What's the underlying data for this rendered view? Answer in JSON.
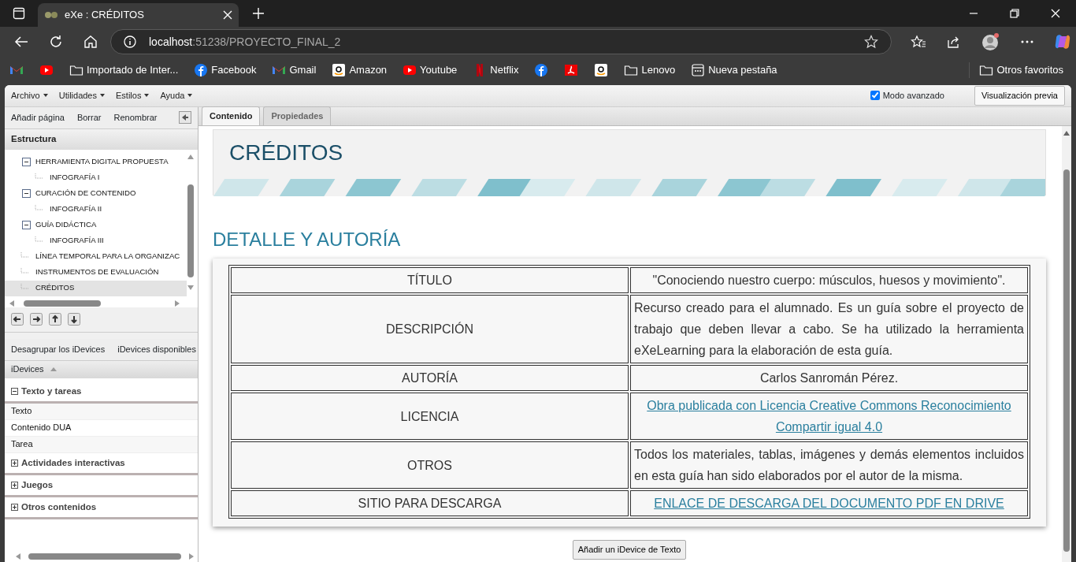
{
  "browser": {
    "tab_title": "eXe : CRÉDITOS",
    "address_host": "localhost",
    "address_rest": ":51238/PROYECTO_FINAL_2",
    "bookmarks": [
      {
        "kind": "gmail"
      },
      {
        "kind": "youtube"
      },
      {
        "kind": "folder",
        "label": "Importado de Inter..."
      },
      {
        "kind": "facebook",
        "label": "Facebook"
      },
      {
        "kind": "gmail",
        "label": "Gmail"
      },
      {
        "kind": "amazon",
        "label": "Amazon"
      },
      {
        "kind": "youtube",
        "label": "Youtube"
      },
      {
        "kind": "netflix",
        "label": "Netflix"
      },
      {
        "kind": "facebook"
      },
      {
        "kind": "santander"
      },
      {
        "kind": "amazon"
      },
      {
        "kind": "folder",
        "label": "Lenovo"
      },
      {
        "kind": "page",
        "label": "Nueva pestaña"
      }
    ],
    "other_favorites": "Otros favoritos"
  },
  "app": {
    "menus": [
      "Archivo",
      "Utilidades",
      "Estilos",
      "Ayuda"
    ],
    "advanced_mode": {
      "label": "Modo avanzado",
      "checked": true
    },
    "preview_button": "Visualización previa",
    "outline_toolbar": [
      "Añadir página",
      "Borrar",
      "Renombrar"
    ],
    "structure_title": "Estructura",
    "tree": [
      {
        "label": "HERRAMIENTA DIGITAL PROPUESTA",
        "expanded": true,
        "selected": false,
        "children": [
          {
            "label": "INFOGRAFÍA I",
            "selected": false
          }
        ]
      },
      {
        "label": "CURACIÓN DE CONTENIDO",
        "expanded": true,
        "selected": false,
        "children": [
          {
            "label": "INFOGRAFÍA II",
            "selected": false
          }
        ]
      },
      {
        "label": "GUÍA DIDÁCTICA",
        "expanded": true,
        "selected": false,
        "children": [
          {
            "label": "INFOGRAFÍA III",
            "selected": false
          }
        ]
      },
      {
        "label": "LÍNEA TEMPORAL PARA LA ORGANIZAC",
        "selected": false
      },
      {
        "label": "INSTRUMENTOS DE EVALUACIÓN",
        "selected": false
      },
      {
        "label": "CRÉDITOS",
        "selected": true
      }
    ],
    "idevices_toolbar": [
      "Desagrupar los iDevices",
      "iDevices disponibles"
    ],
    "idevices_header": "iDevices",
    "idevice_groups": [
      {
        "title": "Texto y tareas",
        "expanded": true,
        "items": [
          "Texto",
          "Contenido DUA",
          "Tarea"
        ]
      },
      {
        "title": "Actividades interactivas",
        "expanded": false
      },
      {
        "title": "Juegos",
        "expanded": false
      },
      {
        "title": "Otros contenidos",
        "expanded": false
      }
    ],
    "tabs": [
      {
        "label": "Contenido",
        "selected": true
      },
      {
        "label": "Propiedades",
        "selected": false
      }
    ],
    "page_title": "CRÉDITOS",
    "section_heading": "DETALLE Y AUTORÍA",
    "table": [
      {
        "label": "TÍTULO",
        "kind": "short",
        "value": "\"Conociendo nuestro cuerpo: músculos, huesos y movimiento\"."
      },
      {
        "label": "DESCRIPCIÓN",
        "kind": "paragraph",
        "value": "Recurso creado para el alumnado. Es un guía sobre el proyecto de trabajo que deben llevar a cabo. Se ha utilizado la herramienta eXeLearning para la elaboración de esta guía."
      },
      {
        "label": "AUTORÍA",
        "kind": "short",
        "value": "Carlos Sanromán Pérez."
      },
      {
        "label": "LICENCIA",
        "kind": "link",
        "value": "Obra publicada con Licencia Creative Commons Reconocimiento Compartir igual 4.0"
      },
      {
        "label": "OTROS",
        "kind": "paragraph",
        "value": "Todos los materiales, tablas, imágenes y demás elementos incluidos en esta guía han sido elaborados por el autor de la misma."
      },
      {
        "label": "SITIO PARA DESCARGA",
        "kind": "link",
        "value": "ENLACE DE DESCARGA DEL DOCUMENTO PDF EN DRIVE"
      }
    ],
    "add_button": "Añadir un iDevice de Texto"
  }
}
